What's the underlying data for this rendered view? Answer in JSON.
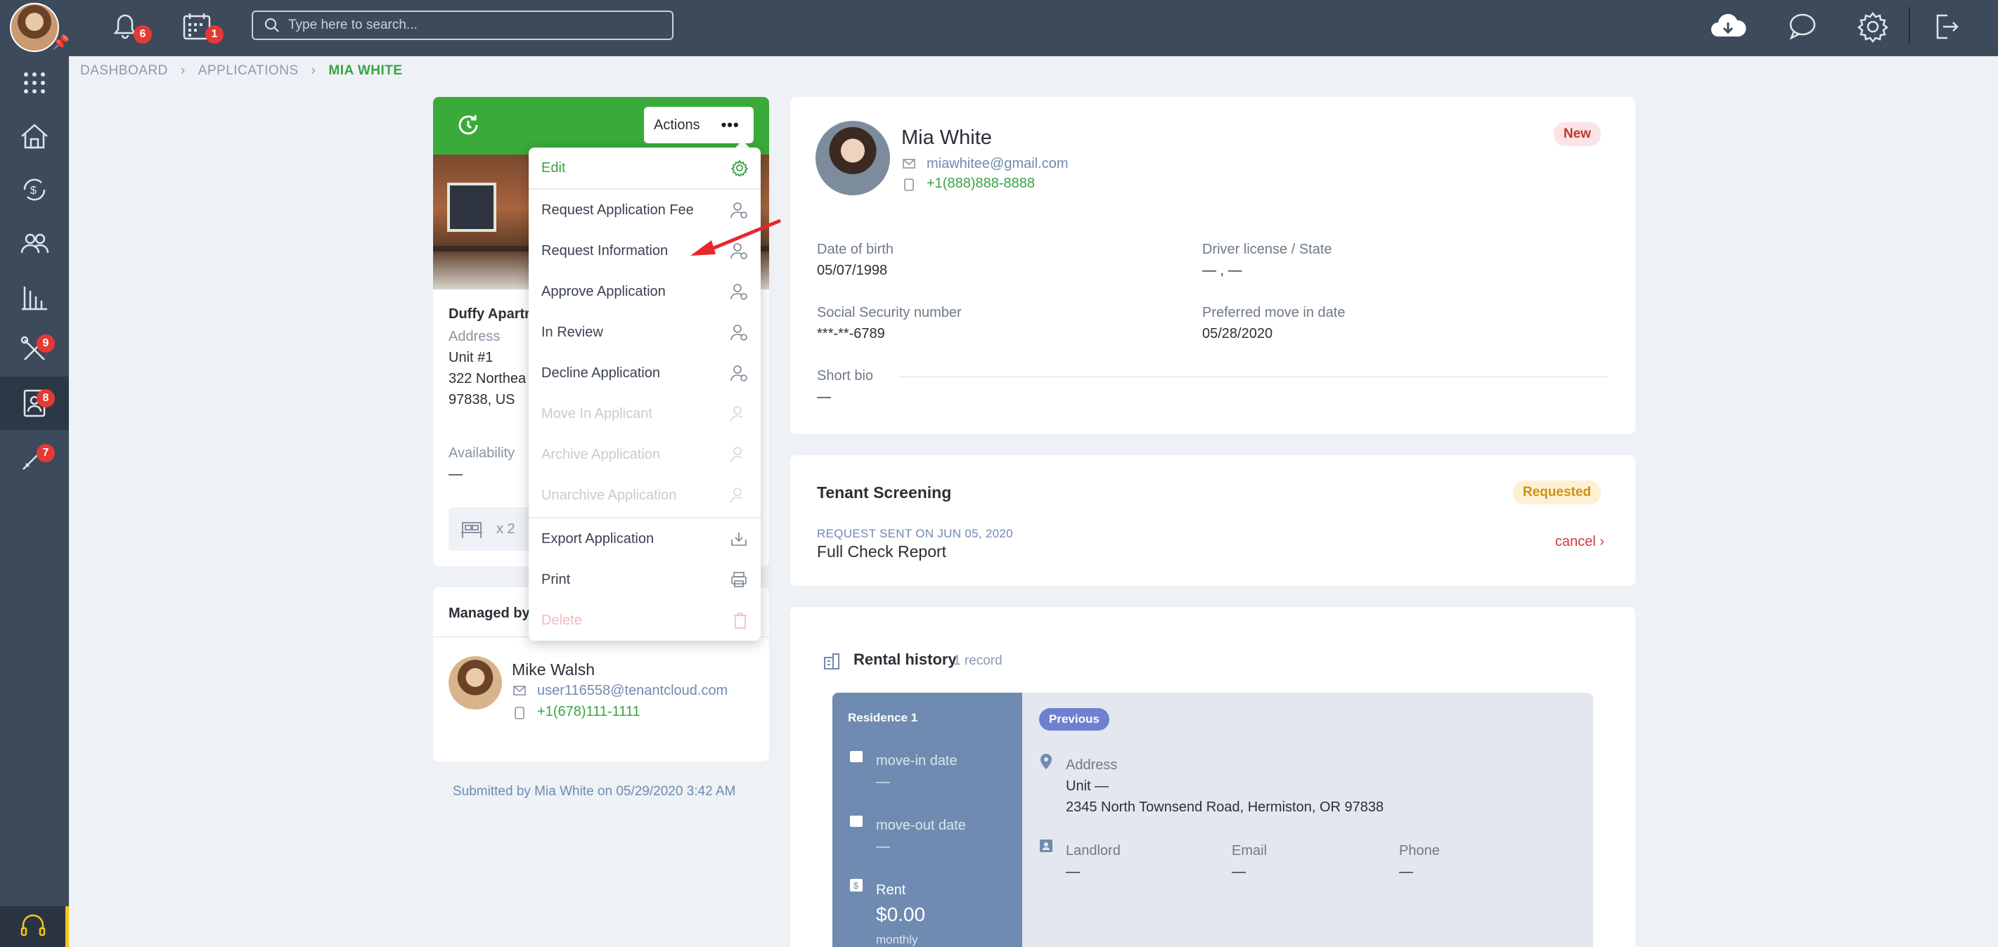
{
  "topbar": {
    "notifications_count": "6",
    "calendar_count": "1",
    "search_placeholder": "Type here to search..."
  },
  "sidebar": {
    "badges": {
      "maintenance": "9",
      "applications": "8",
      "tools": "7"
    }
  },
  "breadcrumb": {
    "items": [
      "DASHBOARD",
      "APPLICATIONS",
      "MIA WHITE"
    ]
  },
  "property_card": {
    "actions_label": "Actions",
    "name": "Duffy Apartm",
    "address_label": "Address",
    "unit": "Unit #1",
    "street": "322 Northea",
    "zip": "97838, US",
    "availability_label": "Availability",
    "availability_value": "—",
    "beds": "x 2"
  },
  "actions_menu": {
    "items": [
      {
        "label": "Edit",
        "state": "primary"
      },
      {
        "label": "Request Application Fee",
        "state": "normal"
      },
      {
        "label": "Request Information",
        "state": "normal"
      },
      {
        "label": "Approve Application",
        "state": "normal"
      },
      {
        "label": "In Review",
        "state": "normal"
      },
      {
        "label": "Decline Application",
        "state": "normal"
      },
      {
        "label": "Move In Applicant",
        "state": "disabled"
      },
      {
        "label": "Archive Application",
        "state": "disabled"
      },
      {
        "label": "Unarchive Application",
        "state": "disabled"
      },
      {
        "label": "Export Application",
        "state": "normal"
      },
      {
        "label": "Print",
        "state": "normal"
      },
      {
        "label": "Delete",
        "state": "disabled"
      }
    ]
  },
  "managed_by": {
    "title": "Managed by",
    "name": "Mike Walsh",
    "email": "user116558@tenantcloud.com",
    "phone": "+1(678)111-1111"
  },
  "submitted_text": "Submitted by Mia White on 05/29/2020 3:42 AM",
  "applicant": {
    "name": "Mia White",
    "email": "miawhitee@gmail.com",
    "phone": "+1(888)888-8888",
    "status": "New",
    "dob_label": "Date of birth",
    "dob": "05/07/1998",
    "license_label": "Driver license / State",
    "license": "— , —",
    "ssn_label": "Social Security number",
    "ssn": "***-**-6789",
    "move_in_label": "Preferred move in date",
    "move_in": "05/28/2020",
    "bio_label": "Short bio",
    "bio": "—"
  },
  "screening": {
    "title": "Tenant Screening",
    "status": "Requested",
    "sent": "REQUEST SENT ON JUN 05, 2020",
    "report": "Full Check Report",
    "cancel": "cancel"
  },
  "rental_history": {
    "title": "Rental history",
    "count": "1 record",
    "residence": {
      "title": "Residence 1",
      "move_in_label": "move-in date",
      "move_in": "—",
      "move_out_label": "move-out date",
      "move_out": "—",
      "rent_label": "Rent",
      "rent": "$0.00",
      "rent_period": "monthly",
      "tag": "Previous",
      "address_label": "Address",
      "unit": "Unit —",
      "address": "2345 North Townsend Road, Hermiston, OR 97838",
      "landlord_label": "Landlord",
      "landlord": "—",
      "email_label": "Email",
      "email": "—",
      "phone_label": "Phone",
      "phone": "—"
    }
  },
  "colors": {
    "brand_green": "#3aaa3a",
    "topbar": "#3d4a5b",
    "badge_red": "#e53935",
    "status_new_bg": "#fbe3e6",
    "status_requested_bg": "#fdf0d5",
    "residence_blue": "#6f8bb1"
  },
  "icons": [
    "notifications-bell-icon",
    "calendar-icon",
    "search-icon",
    "cloud-download-icon",
    "chat-icon",
    "gear-icon",
    "logout-icon",
    "apps-grid-icon",
    "properties-icon",
    "payments-icon",
    "tenants-icon",
    "reports-icon",
    "maintenance-icon",
    "applications-icon",
    "tools-icon",
    "support-icon",
    "refresh-icon",
    "more-dots-icon",
    "mail-icon",
    "phone-icon",
    "bed-icon",
    "pin-icon",
    "calendar-small-icon",
    "dollar-icon",
    "landlord-icon",
    "building-icon"
  ]
}
